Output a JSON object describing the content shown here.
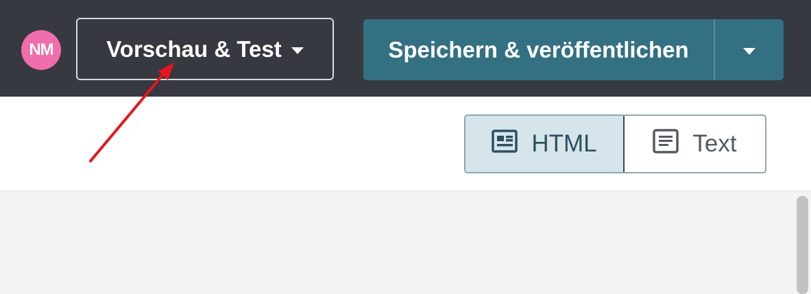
{
  "header": {
    "avatar_initials": "NM",
    "preview_button_label": "Vorschau & Test",
    "publish_button_label": "Speichern & veröffentlichen"
  },
  "view_toggle": {
    "html_label": "HTML",
    "text_label": "Text",
    "selected": "HTML"
  },
  "icons": {
    "preview_caret": "caret-down-icon",
    "publish_caret": "caret-down-icon",
    "html_view": "html-layout-icon",
    "text_view": "text-document-icon"
  },
  "colors": {
    "topbar_bg": "#363940",
    "avatar_bg": "#f06eab",
    "publish_bg": "#337082",
    "html_toggle_bg": "#d6e5ec",
    "annotation_arrow": "#e8141c"
  }
}
